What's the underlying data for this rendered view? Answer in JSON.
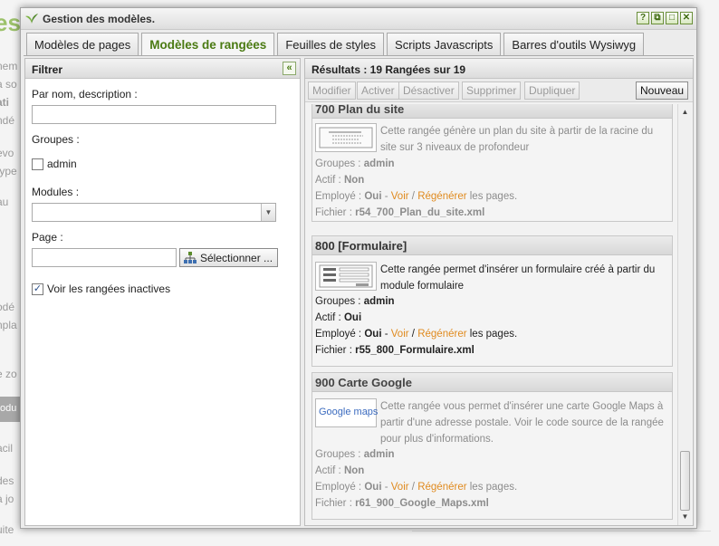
{
  "background": {
    "title_fragment": "es",
    "lines": [
      "nem",
      "a so",
      "ati",
      "ndé",
      "evo",
      "type",
      "au",
      "odé",
      "npla",
      "e zo",
      "odu",
      "acil",
      "des",
      "à jo",
      "uite"
    ],
    "bar_text": "odu"
  },
  "window": {
    "title": "Gestion des modèles.",
    "controls": [
      "?",
      "⧉",
      "□",
      "✕"
    ]
  },
  "tabs": [
    {
      "label": "Modèles de pages"
    },
    {
      "label": "Modèles de rangées"
    },
    {
      "label": "Feuilles de styles"
    },
    {
      "label": "Scripts Javascripts"
    },
    {
      "label": "Barres d'outils Wysiwyg"
    }
  ],
  "filter": {
    "title": "Filtrer",
    "collapse_glyph": "«",
    "name_label": "Par nom, description :",
    "name_value": "",
    "groups_label": "Groupes :",
    "group_admin": "admin",
    "modules_label": "Modules :",
    "modules_value": "",
    "page_label": "Page :",
    "page_value": "",
    "select_button": "Sélectionner ...",
    "inactive_label": "Voir les rangées inactives",
    "inactive_checked": true
  },
  "results": {
    "header": "Résultats : 19 Rangées sur 19",
    "toolbar": {
      "modify": "Modifier",
      "activate": "Activer",
      "deactivate": "Désactiver",
      "delete": "Supprimer",
      "duplicate": "Dupliquer",
      "new": "Nouveau"
    },
    "items": [
      {
        "title": "700 Plan du site",
        "description": "Cette rangée génère un plan du site à partir de la racine du site sur 3 niveaux de profondeur",
        "groups_label": "Groupes :",
        "groups": "admin",
        "active_label": "Actif :",
        "active": "Non",
        "used_label": "Employé :",
        "used": "Oui",
        "sep1": "-",
        "view": "Voir",
        "sep2": "/",
        "regen": "Régénérer",
        "pages": "les pages.",
        "file_label": "Fichier :",
        "file": "r54_700_Plan_du_site.xml"
      },
      {
        "title": "800 [Formulaire]",
        "description": "Cette rangée permet d'insérer un formulaire créé à partir du module formulaire",
        "groups_label": "Groupes :",
        "groups": "admin",
        "active_label": "Actif :",
        "active": "Oui",
        "used_label": "Employé :",
        "used": "Oui",
        "sep1": "-",
        "view": "Voir",
        "sep2": "/",
        "regen": "Régénérer",
        "pages": "les pages.",
        "file_label": "Fichier :",
        "file": "r55_800_Formulaire.xml"
      },
      {
        "title": "900 Carte Google",
        "description": "Cette rangée vous permet d'insérer une carte Google Maps à partir d'une adresse postale. Voir le code source de la rangée pour plus d'informations.",
        "thumb_text": "Google maps",
        "groups_label": "Groupes :",
        "groups": "admin",
        "active_label": "Actif :",
        "active": "Non",
        "used_label": "Employé :",
        "used": "Oui",
        "sep1": "-",
        "view": "Voir",
        "sep2": "/",
        "regen": "Régénérer",
        "pages": "les pages.",
        "file_label": "Fichier :",
        "file": "r61_900_Google_Maps.xml"
      }
    ]
  },
  "colors": {
    "accent_green": "#4a7a12",
    "link_orange": "#e08a1e",
    "inactive_text": "#8c8c8c"
  }
}
